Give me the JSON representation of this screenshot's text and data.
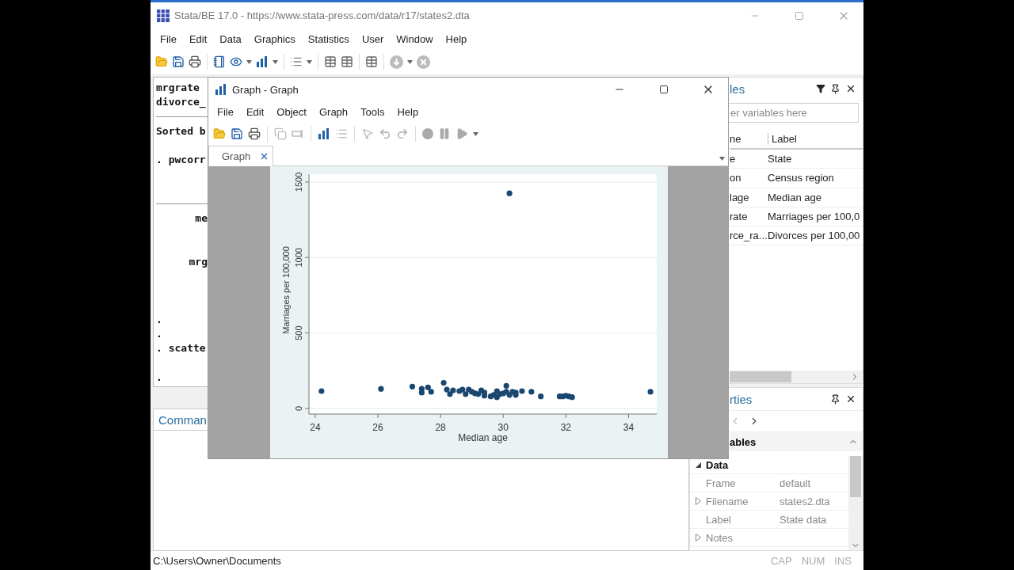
{
  "main_window": {
    "title": "Stata/BE 17.0 - https://www.stata-press.com/data/r17/states2.dta",
    "menu": [
      "File",
      "Edit",
      "Data",
      "Graphics",
      "Statistics",
      "User",
      "Window",
      "Help"
    ],
    "results": [
      {
        "kind": "text",
        "text": "mrgrate"
      },
      {
        "kind": "text",
        "text": "divorce_"
      },
      {
        "kind": "rule"
      },
      {
        "kind": "text",
        "text": "Sorted b"
      },
      {
        "kind": "blank"
      },
      {
        "kind": "text",
        "text": ". pwcorr"
      },
      {
        "kind": "blank"
      },
      {
        "kind": "blank"
      },
      {
        "kind": "rule"
      },
      {
        "kind": "stat",
        "text": "me"
      },
      {
        "kind": "blank"
      },
      {
        "kind": "blank"
      },
      {
        "kind": "stat",
        "text": "mrg"
      },
      {
        "kind": "blank"
      },
      {
        "kind": "blank"
      },
      {
        "kind": "blank"
      },
      {
        "kind": "text",
        "text": "."
      },
      {
        "kind": "text",
        "text": "."
      },
      {
        "kind": "text",
        "text": ". scatte"
      },
      {
        "kind": "blank"
      },
      {
        "kind": "text",
        "text": "."
      }
    ],
    "command_title": "Comman",
    "variables": {
      "title": "les",
      "filter_placeholder": "er variables here",
      "columns": [
        "ne",
        "Label"
      ],
      "rows": [
        {
          "name": "e",
          "label": "State"
        },
        {
          "name": "on",
          "label": "Census region"
        },
        {
          "name": "lage",
          "label": "Median age"
        },
        {
          "name": "rate",
          "label": "Marriages per 100,0"
        },
        {
          "name": "rce_ra...",
          "label": "Divorces per 100,00"
        }
      ]
    },
    "properties": {
      "title": "rties",
      "section": "ables",
      "group": "Data",
      "rows": [
        {
          "name": "Frame",
          "value": "default",
          "expandable": false
        },
        {
          "name": "Filename",
          "value": "states2.dta",
          "expandable": true
        },
        {
          "name": "Label",
          "value": "State data",
          "expandable": false
        },
        {
          "name": "Notes",
          "expandable": true
        }
      ]
    },
    "status_bar": {
      "path": "C:\\Users\\Owner\\Documents",
      "indicators": [
        {
          "label": "CAP",
          "on": false
        },
        {
          "label": "NUM",
          "on": false
        },
        {
          "label": "INS",
          "on": false
        }
      ]
    }
  },
  "graph_window": {
    "title": "Graph - Graph",
    "menu": [
      "File",
      "Edit",
      "Object",
      "Graph",
      "Tools",
      "Help"
    ],
    "tabs": [
      {
        "label": "Graph",
        "selected": true
      }
    ],
    "chart_data": {
      "type": "scatter",
      "xlabel": "Median age",
      "ylabel": "Marriages per 100,000",
      "grid": true,
      "xlim": [
        23.8,
        34.9
      ],
      "ylim": [
        -37,
        1552
      ],
      "xticks": [
        24,
        26,
        28,
        30,
        32,
        34
      ],
      "yticks": [
        0,
        500,
        1000,
        1500
      ],
      "x": [
        24.2,
        26.1,
        27.1,
        27.4,
        27.4,
        27.6,
        27.7,
        28.1,
        28.2,
        28.3,
        28.4,
        28.6,
        28.7,
        28.8,
        28.9,
        29.0,
        29.1,
        29.2,
        29.3,
        29.4,
        29.4,
        29.6,
        29.7,
        29.8,
        29.8,
        29.9,
        30.0,
        30.1,
        30.1,
        30.2,
        30.2,
        30.3,
        30.4,
        30.4,
        30.6,
        30.9,
        31.2,
        31.8,
        31.9,
        32.0,
        32.1,
        32.2,
        34.7
      ],
      "series": [
        {
          "color": "#1a476f",
          "values": [
            115,
            130,
            145,
            130,
            105,
            140,
            110,
            170,
            125,
            95,
            120,
            115,
            125,
            95,
            125,
            110,
            100,
            95,
            120,
            105,
            85,
            80,
            90,
            115,
            75,
            95,
            100,
            150,
            110,
            90,
            1425,
            110,
            90,
            105,
            115,
            110,
            80,
            80,
            80,
            85,
            80,
            75,
            110
          ]
        }
      ]
    }
  }
}
